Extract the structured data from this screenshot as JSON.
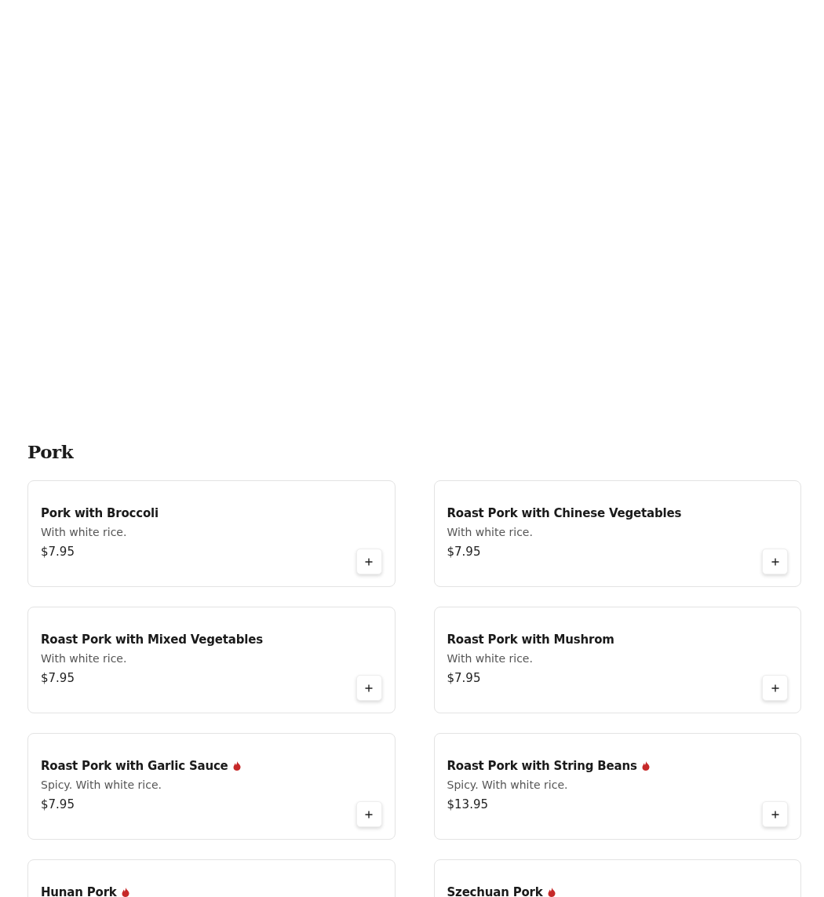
{
  "section": {
    "title": "Pork",
    "items": [
      {
        "name": "Pork with Broccoli",
        "spicy": false,
        "description": "With white rice.",
        "price": "$7.95"
      },
      {
        "name": "Roast Pork with Chinese Vegetables",
        "spicy": false,
        "description": "With white rice.",
        "price": "$7.95"
      },
      {
        "name": "Roast Pork with Mixed Vegetables",
        "spicy": false,
        "description": "With white rice.",
        "price": "$7.95"
      },
      {
        "name": "Roast Pork with Mushrom",
        "spicy": false,
        "description": "With white rice.",
        "price": "$7.95"
      },
      {
        "name": "Roast Pork with Garlic Sauce",
        "spicy": true,
        "description": "Spicy. With white rice.",
        "price": "$7.95"
      },
      {
        "name": "Roast Pork with String Beans",
        "spicy": true,
        "description": "Spicy. With white rice.",
        "price": "$13.95"
      },
      {
        "name": "Hunan Pork",
        "spicy": true
      },
      {
        "name": "Szechuan Pork",
        "spicy": true
      }
    ]
  }
}
